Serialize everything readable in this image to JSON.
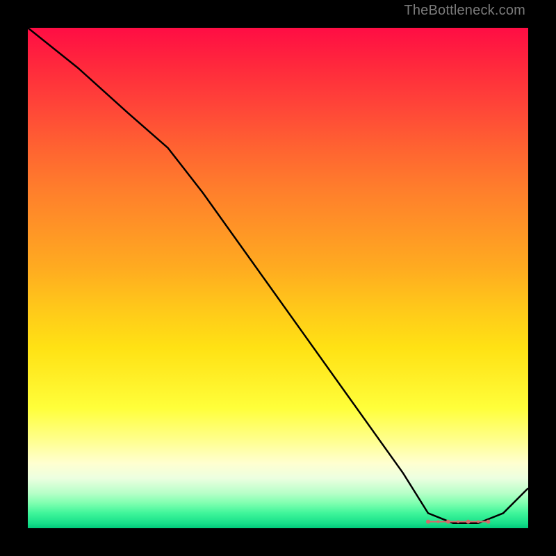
{
  "watermark": "TheBottleneck.com",
  "chart_data": {
    "type": "line",
    "title": "",
    "xlabel": "",
    "ylabel": "",
    "xlim": [
      0,
      100
    ],
    "ylim": [
      0,
      100
    ],
    "grid": false,
    "legend": false,
    "series": [
      {
        "name": "curve",
        "x": [
          0,
          10,
          20,
          28,
          35,
          45,
          55,
          65,
          75,
          80,
          85,
          90,
          95,
          100
        ],
        "values": [
          100,
          92,
          83,
          76,
          67,
          53,
          39,
          25,
          11,
          3,
          1,
          1,
          3,
          8
        ]
      }
    ],
    "annotations": [
      {
        "name": "floor-markers",
        "x": 87,
        "y": 1.5,
        "text": "",
        "style": "pink-dots"
      }
    ],
    "background_gradient": {
      "top_color": "#ff0d44",
      "mid_colors": [
        "#ff9426",
        "#ffe214",
        "#ffff88"
      ],
      "bottom_color": "#00c97a"
    }
  },
  "labels": {
    "floor_text": ""
  },
  "colors": {
    "line": "#000000",
    "marker": "#d46a6a",
    "watermark": "#7b7b7b",
    "frame": "#000000"
  }
}
